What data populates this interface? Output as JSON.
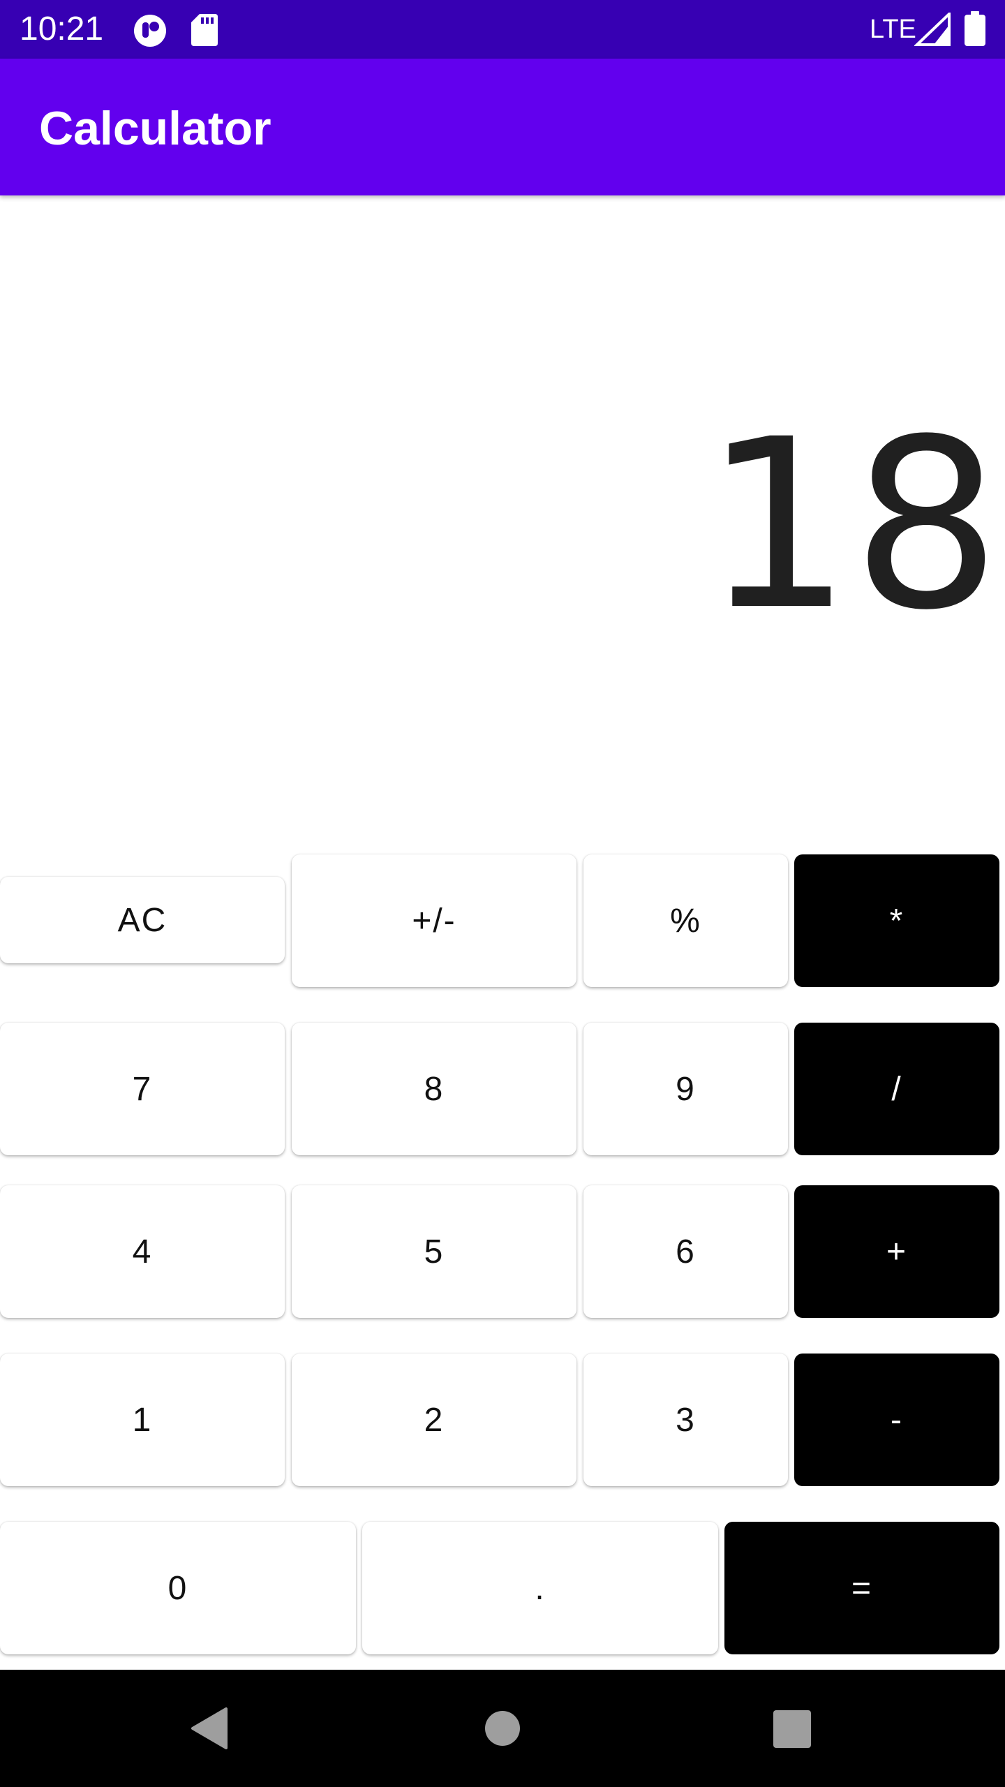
{
  "status_bar": {
    "time": "10:21",
    "network_label": "LTE",
    "icons": [
      "notification-app-icon",
      "sd-card-icon",
      "signal-icon",
      "battery-icon"
    ]
  },
  "app_bar": {
    "title": "Calculator"
  },
  "display": {
    "value": "18"
  },
  "keypad": {
    "row1": {
      "clear": "AC",
      "sign": "+/-",
      "percent": "%",
      "multiply": "*"
    },
    "row2": {
      "seven": "7",
      "eight": "8",
      "nine": "9",
      "divide": "/"
    },
    "row3": {
      "four": "4",
      "five": "5",
      "six": "6",
      "add": "+"
    },
    "row4": {
      "one": "1",
      "two": "2",
      "three": "3",
      "subtract": "-"
    },
    "row5": {
      "zero": "0",
      "decimal": ".",
      "equals": "="
    }
  },
  "nav_bar": {
    "icons": [
      "back-icon",
      "home-icon",
      "recents-icon"
    ]
  },
  "colors": {
    "status_bar": "#3700b3",
    "app_bar": "#6200ee",
    "operator_key": "#000000",
    "number_key": "#ffffff",
    "display_text": "#202020"
  }
}
